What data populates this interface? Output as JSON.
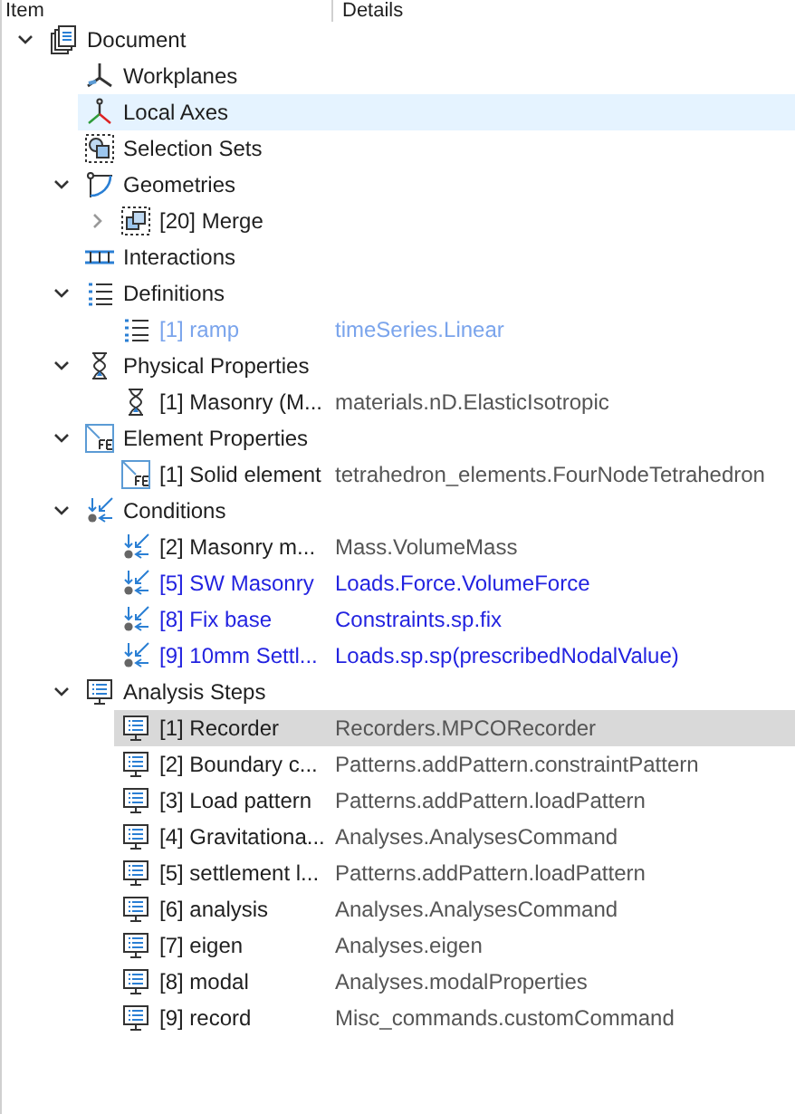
{
  "columns": [
    "Item",
    "Details"
  ],
  "tree": [
    {
      "label": "Document",
      "kind": "document",
      "expanded": true,
      "children": [
        {
          "label": "Workplanes",
          "kind": "workplane"
        },
        {
          "label": "Local Axes",
          "kind": "axes",
          "hovered": true
        },
        {
          "label": "Selection Sets",
          "kind": "selection"
        },
        {
          "label": "Geometries",
          "kind": "geometry",
          "expanded": true,
          "children": [
            {
              "label": "[20] Merge",
              "kind": "merge",
              "expanded": false
            }
          ]
        },
        {
          "label": "Interactions",
          "kind": "interactions"
        },
        {
          "label": "Definitions",
          "kind": "list",
          "expanded": true,
          "children": [
            {
              "label": "[1] ramp",
              "kind": "list",
              "details": "timeSeries.Linear",
              "color": "#7aa4ec"
            }
          ]
        },
        {
          "label": "Physical Properties",
          "kind": "hourglass",
          "expanded": true,
          "children": [
            {
              "label": "[1] Masonry (M...",
              "kind": "hourglass",
              "details": "materials.nD.ElasticIsotropic"
            }
          ]
        },
        {
          "label": "Element Properties",
          "kind": "fe",
          "expanded": true,
          "children": [
            {
              "label": "[1] Solid element",
              "kind": "fe",
              "details": "tetrahedron_elements.FourNodeTetrahedron"
            }
          ]
        },
        {
          "label": "Conditions",
          "kind": "condition",
          "expanded": true,
          "children": [
            {
              "label": "[2] Masonry m...",
              "kind": "condition",
              "details": "Mass.VolumeMass"
            },
            {
              "label": "[5] SW Masonry",
              "kind": "condition",
              "details": "Loads.Force.VolumeForce",
              "color": "#2323e0"
            },
            {
              "label": "[8] Fix base",
              "kind": "condition",
              "details": "Constraints.sp.fix",
              "color": "#2323e0"
            },
            {
              "label": "[9] 10mm Settl...",
              "kind": "condition",
              "details": "Loads.sp.sp(prescribedNodalValue)",
              "color": "#2323e0"
            }
          ]
        },
        {
          "label": "Analysis Steps",
          "kind": "monitor",
          "expanded": true,
          "children": [
            {
              "label": "[1] Recorder",
              "kind": "monitor",
              "details": "Recorders.MPCORecorder",
              "selected": true
            },
            {
              "label": "[2] Boundary c...",
              "kind": "monitor",
              "details": "Patterns.addPattern.constraintPattern",
              "selected": false
            },
            {
              "label": "[3] Load pattern",
              "kind": "monitor",
              "details": "Patterns.addPattern.loadPattern",
              "selected": false
            },
            {
              "label": "[4] Gravitationa...",
              "kind": "monitor",
              "details": "Analyses.AnalysesCommand",
              "selected": false
            },
            {
              "label": "[5] settlement l...",
              "kind": "monitor",
              "details": "Patterns.addPattern.loadPattern",
              "selected": false
            },
            {
              "label": "[6] analysis",
              "kind": "monitor",
              "details": "Analyses.AnalysesCommand",
              "selected": false
            },
            {
              "label": "[7] eigen",
              "kind": "monitor",
              "details": "Analyses.eigen",
              "selected": false
            },
            {
              "label": "[8] modal",
              "kind": "monitor",
              "details": "Analyses.modalProperties",
              "selected": false
            },
            {
              "label": "[9] record",
              "kind": "monitor",
              "details": "Misc_commands.customCommand",
              "selected": false
            }
          ]
        }
      ]
    }
  ]
}
